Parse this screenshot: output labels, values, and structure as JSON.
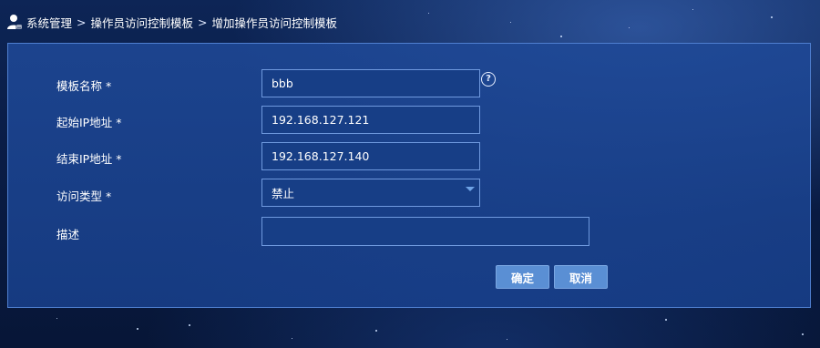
{
  "breadcrumb": {
    "items": [
      "系统管理",
      "操作员访问控制模板",
      "增加操作员访问控制模板"
    ],
    "separator": ">"
  },
  "form": {
    "template_name": {
      "label": "模板名称 *",
      "value": "bbb"
    },
    "start_ip": {
      "label": "起始IP地址 *",
      "value": "192.168.127.121"
    },
    "end_ip": {
      "label": "结束IP地址 *",
      "value": "192.168.127.140"
    },
    "access_type": {
      "label": "访问类型 *",
      "value": "禁止"
    },
    "description": {
      "label": "描述",
      "value": ""
    }
  },
  "help_icon": {
    "glyph": "?"
  },
  "buttons": {
    "confirm": "确定",
    "cancel": "取消"
  },
  "colors": {
    "panel": "#1e4896",
    "field_border": "#6f99de",
    "button": "#5a8fd4"
  },
  "icons": {
    "breadcrumb": "user-icon",
    "help": "question-circle-icon",
    "dropdown": "chevron-down-icon"
  }
}
